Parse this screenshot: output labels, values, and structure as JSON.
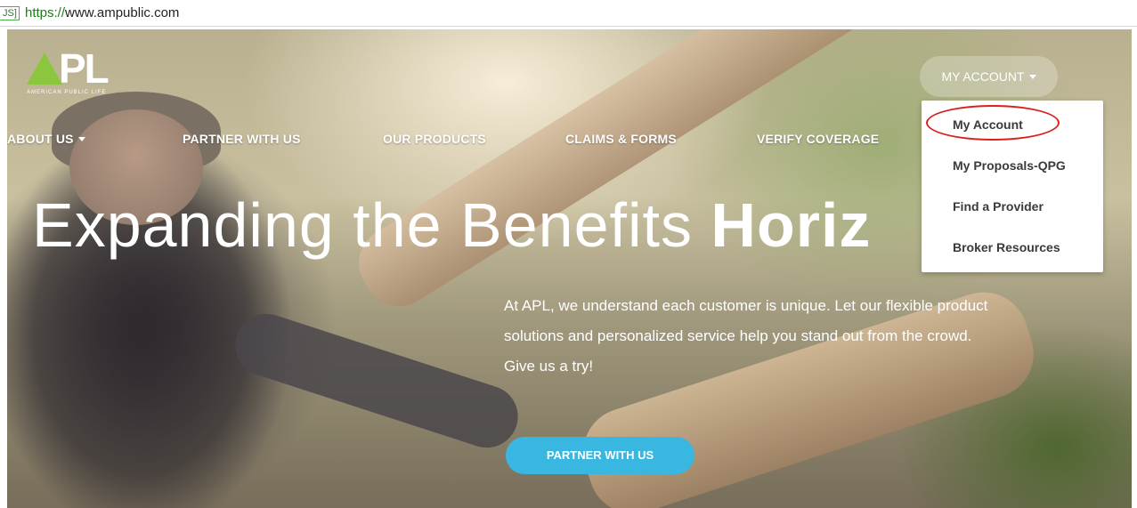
{
  "browser": {
    "badge": "JS]",
    "url_scheme": "https://",
    "url_host": "www.ampublic.com"
  },
  "brand": {
    "logo_text": "PL",
    "logo_tagline": "AMERICAN PUBLIC LIFE",
    "accent_green": "#8cc63f",
    "accent_blue": "#3ab7e0"
  },
  "nav": {
    "items": [
      "ABOUT US",
      "PARTNER WITH US",
      "OUR PRODUCTS",
      "CLAIMS & FORMS",
      "VERIFY COVERAGE"
    ],
    "account_label": "MY ACCOUNT"
  },
  "dropdown": {
    "items": [
      "My Account",
      "My Proposals-QPG",
      "Find a Provider",
      "Broker Resources"
    ],
    "highlight_color": "#d8201f"
  },
  "hero": {
    "headline_light": "Expanding the Benefits ",
    "headline_bold": "Horiz",
    "body": "At APL, we understand each customer is unique. Let our flexible product solutions and personalized service help you stand out from the crowd. Give us a try!",
    "cta_label": "PARTNER WITH US"
  }
}
